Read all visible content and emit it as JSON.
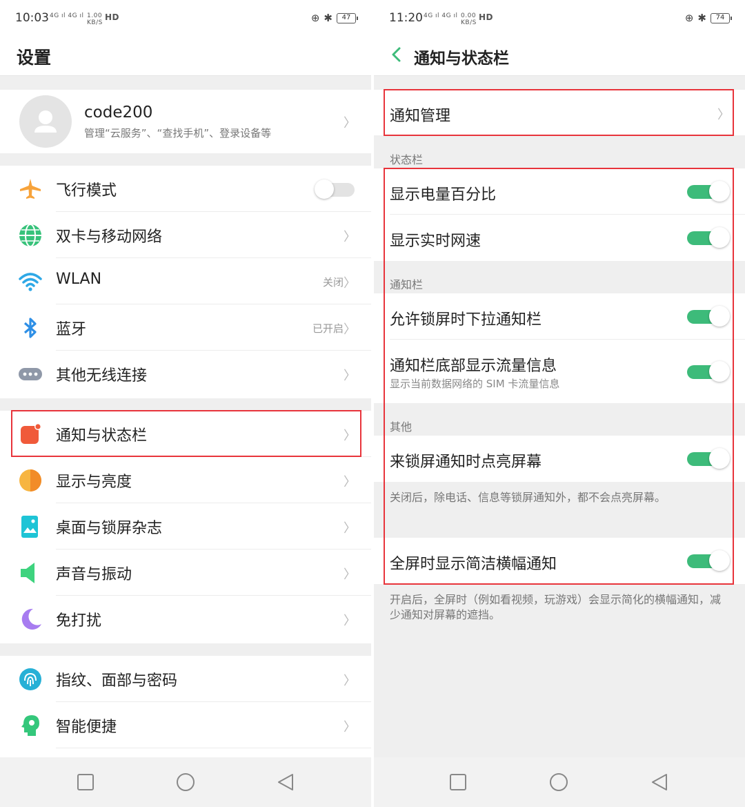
{
  "left": {
    "status_time": "10:03",
    "status_net": "4G ıl 4G ıl",
    "status_speed": "1.00",
    "status_speed_unit": "KB/S",
    "status_hd": "HD",
    "battery": "47",
    "title": "设置",
    "account": {
      "name": "code200",
      "subtitle": "管理“云服务”、“查找手机”、登录设备等"
    },
    "items": [
      {
        "label": "飞行模式",
        "value": "",
        "control": "toggle-off"
      },
      {
        "label": "双卡与移动网络",
        "value": "",
        "control": "chevron"
      },
      {
        "label": "WLAN",
        "value": "关闭",
        "control": "chevron"
      },
      {
        "label": "蓝牙",
        "value": "已开启",
        "control": "chevron"
      },
      {
        "label": "其他无线连接",
        "value": "",
        "control": "chevron"
      },
      {
        "label": "通知与状态栏",
        "value": "",
        "control": "chevron"
      },
      {
        "label": "显示与亮度",
        "value": "",
        "control": "chevron"
      },
      {
        "label": "桌面与锁屏杂志",
        "value": "",
        "control": "chevron"
      },
      {
        "label": "声音与振动",
        "value": "",
        "control": "chevron"
      },
      {
        "label": "免打扰",
        "value": "",
        "control": "chevron"
      },
      {
        "label": "指纹、面部与密码",
        "value": "",
        "control": "chevron"
      },
      {
        "label": "智能便捷",
        "value": "",
        "control": "chevron"
      }
    ]
  },
  "right": {
    "status_time": "11:20",
    "status_net": "4G ıl 4G ıl",
    "status_speed": "0.00",
    "status_speed_unit": "KB/S",
    "status_hd": "HD",
    "battery": "74",
    "title": "通知与状态栏",
    "notif_manage": "通知管理",
    "section_status": "状态栏",
    "show_battery_percent": "显示电量百分比",
    "show_net_speed": "显示实时网速",
    "section_notif": "通知栏",
    "allow_pulldown_locked": "允许锁屏时下拉通知栏",
    "show_data_usage": "通知栏底部显示流量信息",
    "show_data_usage_sub": "显示当前数据网络的 SIM 卡流量信息",
    "section_other": "其他",
    "wake_on_notif": "来锁屏通知时点亮屏幕",
    "wake_on_notif_desc": "关闭后，除电话、信息等锁屏通知外，都不会点亮屏幕。",
    "fullscreen_banner": "全屏时显示简洁横幅通知",
    "fullscreen_banner_desc": "开启后，全屏时（例如看视频，玩游戏）会显示简化的横幅通知，减少通知对屏幕的遮挡。"
  },
  "colors": {
    "accent_green": "#3dbb7a",
    "highlight_red": "#e8333a"
  }
}
